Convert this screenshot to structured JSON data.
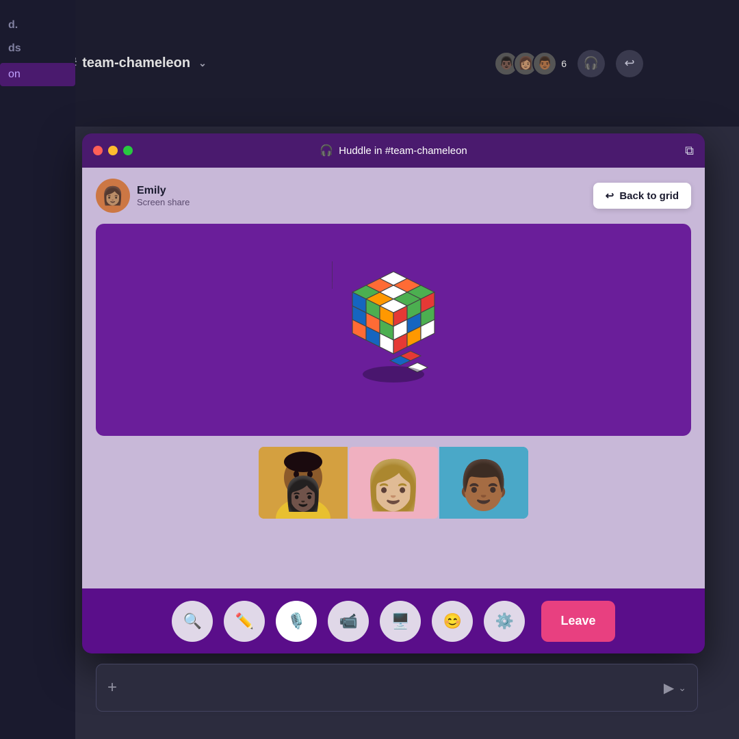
{
  "app": {
    "channel_hash": "#",
    "channel_name": "team-chameleon",
    "member_count": "6",
    "sidebar_items": [
      "d.",
      "ds",
      "on"
    ]
  },
  "huddle": {
    "title": "Huddle in #team-chameleon",
    "presenter_name": "Emily",
    "presenter_status": "Screen share",
    "back_to_grid_label": "Back to grid",
    "leave_label": "Leave"
  },
  "controls": {
    "zoom_icon": "🔍",
    "pen_icon": "✏️",
    "mic_icon": "🎙️",
    "camera_icon": "📹",
    "screen_icon": "🖥️",
    "emoji_icon": "😊",
    "settings_icon": "⚙️"
  },
  "message_bar": {
    "plus_label": "+",
    "send_label": "▶"
  }
}
